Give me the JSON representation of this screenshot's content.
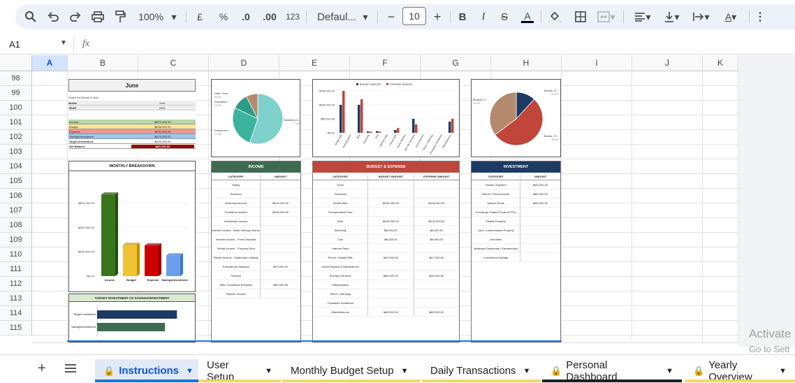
{
  "toolbar": {
    "zoom": "100%",
    "currency": "£",
    "percent": "%",
    "dec_less": ".0",
    "dec_more": ".00",
    "format_123": "123",
    "font": "Defaul...",
    "font_size": "10"
  },
  "formula_bar": {
    "cell_ref": "A1",
    "fx": "fx"
  },
  "columns": [
    "A",
    "B",
    "C",
    "D",
    "E",
    "F",
    "G",
    "H",
    "I",
    "J",
    "K"
  ],
  "rows": [
    "98",
    "99",
    "100",
    "101",
    "102",
    "103",
    "104",
    "105",
    "106",
    "107",
    "108",
    "109",
    "110",
    "111",
    "112",
    "113",
    "114",
    "115"
  ],
  "june": {
    "title": "June",
    "select_label": "Select the Month & Year",
    "month_label": "Month",
    "month_value": "June",
    "year_label": "YEAR",
    "year_value": "2025",
    "summary": [
      {
        "label": "Income",
        "value": "₦670,000.00"
      },
      {
        "label": "Budget",
        "value": "₦256,400.00"
      },
      {
        "label": "Expense",
        "value": "₦251,900.00"
      },
      {
        "label": "Savings/Investment",
        "value": "₦170,000.00"
      },
      {
        "label": "Target Investment",
        "value": "₦200,000.00"
      },
      {
        "label": "Net Balance",
        "value": "₦87,000.00"
      }
    ]
  },
  "monthly": {
    "title": "MONTHLY BREAKDOWN",
    "yticks": [
      "₦600,000.00",
      "₦400,000.00",
      "₦200,000.00",
      "₦0.00"
    ],
    "categories": [
      "Income",
      "Budget",
      "Expense",
      "Savings/Investment"
    ],
    "values": [
      670000,
      256400,
      251900,
      170000
    ]
  },
  "target": {
    "title": "TARGET INVESTMENT VS SAVINGS/INVESTMENT",
    "labels": [
      "Target Investment",
      "Savings/Investment"
    ],
    "values": [
      200000,
      170000
    ]
  },
  "income_pie": {
    "labels": [
      "Gifts / Don..",
      "Education..",
      "Freelance I..",
      "Business In.."
    ],
    "pcts": [
      "7.5%",
      "10.4%",
      "26.9%",
      "55.2%"
    ]
  },
  "budget_chart": {
    "legend": [
      "BUDGET AMOUNT",
      "EXPENSE AMOUNT"
    ],
    "yticks": [
      "₦150,000.00",
      "₦100,000.00",
      "₦50,000.00",
      "₦0.00"
    ],
    "categories": [
      "Mobile Bills",
      "Transportation",
      "Rent",
      "Electricity",
      "Gas",
      "Internet Data",
      "Phone Bills",
      "Home Repairs",
      "Security Services",
      "Subscriptions",
      "Tithes / Offerings",
      "Charitable Donations",
      "Miscellaneous"
    ]
  },
  "invest_pie": {
    "labels": [
      "Stocks / E..",
      "Mutual Fu..",
      "Bonds / Fi.."
    ],
    "pcts": [
      "11.8%",
      "35.3%",
      "52.9%"
    ]
  },
  "income_table": {
    "title": "INCOME",
    "headers": [
      "CATEGORY",
      "AMOUNT"
    ],
    "rows": [
      [
        "Salary",
        ""
      ],
      [
        "Bonuses",
        ""
      ],
      [
        "Business Income",
        "₦320,000.00"
      ],
      [
        "Freelance Income",
        "₦150,000.00"
      ],
      [
        "Investment Income",
        ""
      ],
      [
        "Interest Income - Bank Savings Interest",
        ""
      ],
      [
        "Interest Income - Fixed Deposits",
        ""
      ],
      [
        "Rental Income - Property Rent",
        ""
      ],
      [
        "Rental Income - Equipment Leasing",
        ""
      ],
      [
        "Educational Stipends",
        "₦70,000.00"
      ],
      [
        "Pension",
        ""
      ],
      [
        "Gifts / Donations Received",
        "₦50,000.00"
      ],
      [
        "Passive Income",
        ""
      ]
    ]
  },
  "budget_table": {
    "title": "BUDGET & EXPENSE",
    "headers": [
      "CATEGORY",
      "BUDGET AMOUNT",
      "EXPENSE AMOUNT"
    ],
    "rows": [
      [
        "Food",
        "",
        ""
      ],
      [
        "Groceries",
        "",
        ""
      ],
      [
        "Mobile Bills",
        "₦100,000.00",
        "₦150,000.00"
      ],
      [
        "Transportation Fare",
        "",
        ""
      ],
      [
        "Rent",
        "₦100,000.00",
        "₦120,000.00"
      ],
      [
        "Electricity",
        "₦5,000.00",
        "₦4,000.00"
      ],
      [
        "Gas",
        "₦6,000.00",
        "₦4,000.00"
      ],
      [
        "Internet Data",
        "",
        ""
      ],
      [
        "Phone / Mobile Bills",
        "₦10,000.00",
        "₦17,000.00"
      ],
      [
        "Home Repairs & Maintenance",
        "",
        ""
      ],
      [
        "Security Services",
        "₦50,000.00",
        "₦30,000.00"
      ],
      [
        "Subscriptions",
        "",
        ""
      ],
      [
        "Tithes / Offerings",
        "",
        ""
      ],
      [
        "Charitable Donations",
        "",
        ""
      ],
      [
        "Miscellaneous",
        "₦40,000.00",
        "₦50,000.00"
      ]
    ]
  },
  "invest_table": {
    "title": "INVESTMENT",
    "headers": [
      "CATEGORY",
      "AMOUNT"
    ],
    "rows": [
      [
        "Stocks / Equities",
        "₦20,000.00"
      ],
      [
        "Bonds / Fixed Income",
        "₦60,000.00"
      ],
      [
        "Mutual Funds",
        "₦90,000.00"
      ],
      [
        "Exchange-Traded Funds (ETFs)",
        ""
      ],
      [
        "Rental Property",
        ""
      ],
      [
        "Land / Undeveloped Property",
        ""
      ],
      [
        "Annuities",
        ""
      ],
      [
        "Business Ownership / Partnerships",
        ""
      ],
      [
        "Investment Savings",
        ""
      ]
    ]
  },
  "tabs": [
    {
      "label": "Instructions",
      "locked": true,
      "active": true
    },
    {
      "label": "User Setup",
      "locked": false
    },
    {
      "label": "Monthly Budget Setup",
      "locked": false
    },
    {
      "label": "Daily Transactions",
      "locked": false
    },
    {
      "label": "Personal Dashboard",
      "locked": true
    },
    {
      "label": "Yearly Overview",
      "locked": true
    }
  ],
  "watermark": {
    "line1": "Activate",
    "line2": "Go to Sett"
  }
}
